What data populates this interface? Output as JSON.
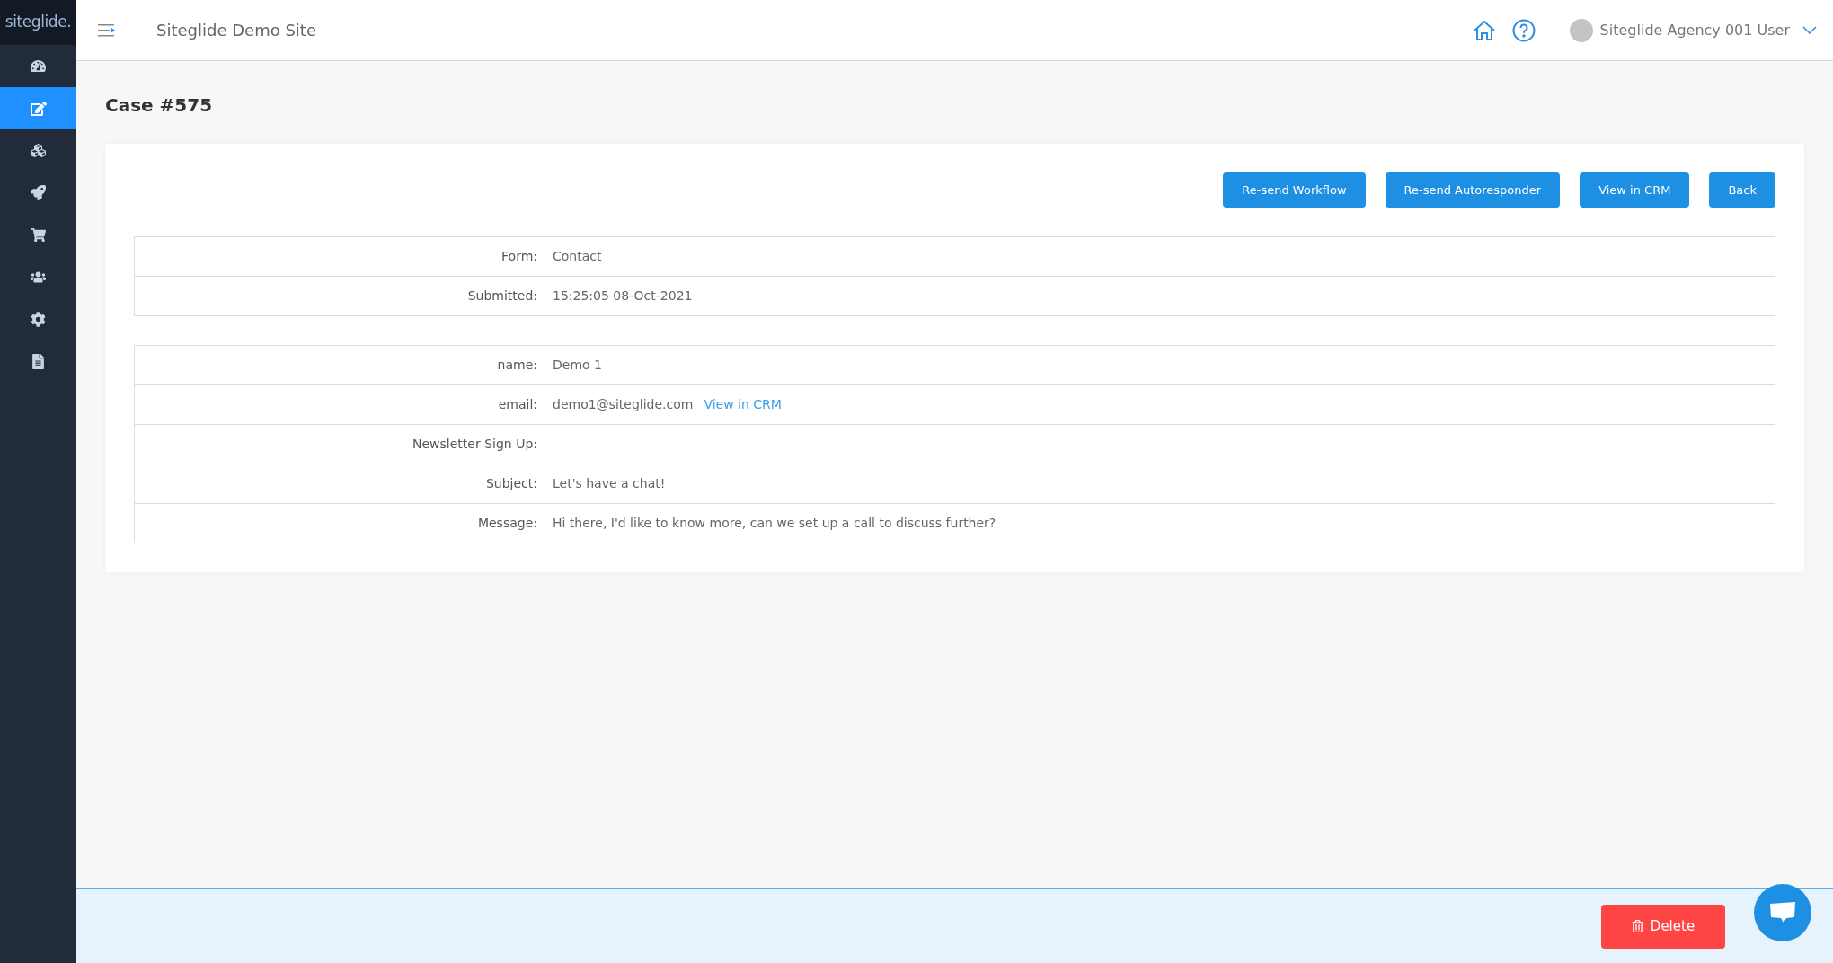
{
  "sidebar": {
    "logo": "siteglide.",
    "items": [
      {
        "selected": false
      },
      {
        "selected": true
      },
      {
        "selected": false
      },
      {
        "selected": false
      },
      {
        "selected": false
      },
      {
        "selected": false
      },
      {
        "selected": false
      },
      {
        "selected": false
      }
    ]
  },
  "header": {
    "site_title": "Siteglide Demo Site",
    "user_name": "Siteglide Agency 001 User"
  },
  "page_title": "Case #575",
  "actions": [
    "Re-send Workflow",
    "Re-send Autoresponder",
    "View in CRM",
    "Back"
  ],
  "meta_table": [
    {
      "label": "Form:",
      "value": "Contact"
    },
    {
      "label": "Submitted:",
      "value": "15:25:05 08-Oct-2021"
    }
  ],
  "fields_table": [
    {
      "label": "name:",
      "value": "Demo 1"
    },
    {
      "label": "email:",
      "value": "demo1@siteglide.com",
      "link": "View in CRM"
    },
    {
      "label": "Newsletter Sign Up:"
    },
    {
      "label": "Subject:",
      "value": "Let's have a chat!"
    },
    {
      "label": "Message:",
      "value": "Hi there, I'd like to know more, can we set up a call to discuss further?"
    }
  ],
  "footer": {
    "delete_button": "Delete"
  }
}
